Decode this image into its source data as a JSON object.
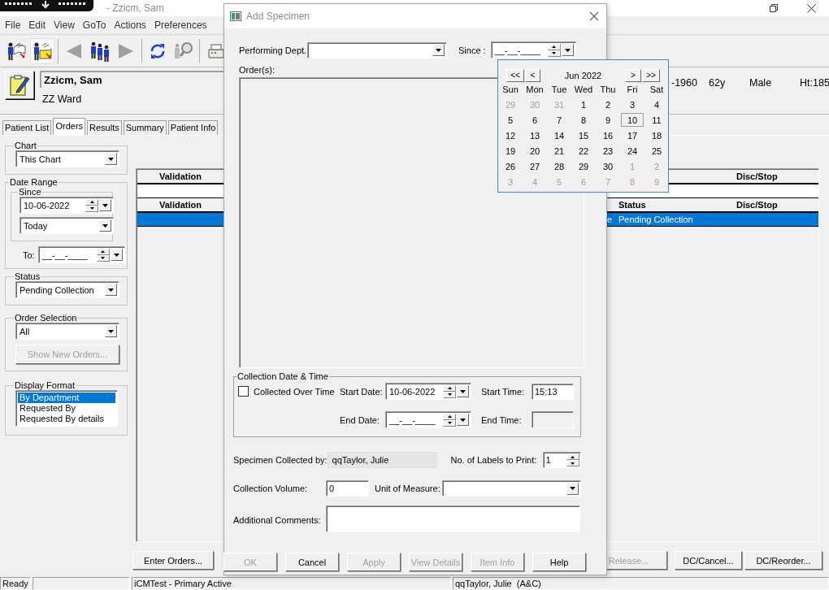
{
  "window": {
    "title": "- Zzicm, Sam"
  },
  "menu": [
    "File",
    "Edit",
    "View",
    "GoTo",
    "Actions",
    "Preferences"
  ],
  "patient": {
    "name": "Zzicm, Sam",
    "ward": "ZZ Ward",
    "dob": "-1960",
    "age": "62y",
    "sex": "Male",
    "height": "Ht:185"
  },
  "tabs": [
    {
      "label": "Patient List",
      "selected": false
    },
    {
      "label": "Orders",
      "selected": true
    },
    {
      "label": "Results",
      "selected": false
    },
    {
      "label": "Summary",
      "selected": false
    },
    {
      "label": "Patient Info",
      "selected": false
    }
  ],
  "filters": {
    "chart": {
      "label": "Chart",
      "value": "This Chart"
    },
    "date_range": {
      "label": "Date Range",
      "since_label": "Since",
      "since_value": "10-06-2022",
      "since_preset": "Today",
      "to_label": "To:",
      "to_value": "__-__-____"
    },
    "status": {
      "label": "Status",
      "value": "Pending Collection"
    },
    "order_selection": {
      "label": "Order Selection",
      "value": "All",
      "button": {
        "label": "Show New Orders...",
        "disabled": true
      }
    },
    "display_format": {
      "label": "Display Format",
      "items": [
        {
          "label": "By Department",
          "selected": true
        },
        {
          "label": "Requested By",
          "selected": false
        },
        {
          "label": "Requested By details",
          "selected": false
        }
      ]
    }
  },
  "orders_tables": [
    {
      "headers": {
        "validation": "Validation",
        "disc_stop": "Disc/Stop"
      },
      "rows": [
        {
          "selected": false
        }
      ]
    },
    {
      "headers": {
        "validation": "Validation",
        "status": "Status",
        "disc_stop": "Disc/Stop"
      },
      "rows": [
        {
          "column_2": "e",
          "status": "Pending Collection",
          "selected": true
        }
      ]
    }
  ],
  "action_buttons": [
    {
      "label": "Enter Orders...",
      "disabled": false
    },
    {
      "label": "Release...",
      "disabled": true
    },
    {
      "label": "DC/Cancel...",
      "disabled": false
    },
    {
      "label": "DC/Reorder...",
      "disabled": false
    }
  ],
  "status_bar": [
    "Ready",
    "iCMTest - Primary Active",
    "qqTaylor, Julie  (A&C)"
  ],
  "dialog": {
    "title": "Add Specimen",
    "performing_dept_label": "Performing Dept.",
    "since_label": "Since :",
    "since_value": "__-__-____",
    "orders_label": "Order(s):",
    "collection": {
      "title": "Collection Date & Time",
      "collected_over_time": {
        "label": "Collected Over Time",
        "checked": false
      },
      "start_date_label": "Start Date:",
      "start_date": "10-06-2022",
      "start_time_label": "Start Time:",
      "start_time": "15:13",
      "end_date_label": "End Date:",
      "end_date": "__-__-____",
      "end_time_label": "End Time:",
      "end_time_disabled": true
    },
    "collected_by_label": "Specimen Collected by:",
    "collected_by": "qqTaylor, Julie",
    "labels_label": "No. of Labels to Print:",
    "labels": "1",
    "volume_label": "Collection Volume:",
    "volume": "0",
    "unit_label": "Unit of Measure:",
    "comments_label": "Additional Comments:",
    "buttons": [
      {
        "label": "OK",
        "disabled": true
      },
      {
        "label": "Cancel",
        "disabled": false
      },
      {
        "label": "Apply",
        "disabled": true
      },
      {
        "label": "View Details",
        "disabled": true
      },
      {
        "label": "Item Info",
        "disabled": true
      },
      {
        "label": "Help",
        "disabled": false
      }
    ]
  },
  "calendar": {
    "month": "Jun 2022",
    "nav_back": [
      "<<",
      "<"
    ],
    "nav_forward": [
      ">",
      ">>"
    ],
    "weekdays": [
      "Sun",
      "Mon",
      "Tue",
      "Wed",
      "Thu",
      "Fri",
      "Sat"
    ],
    "days": [
      {
        "label": "29",
        "other_month": true,
        "selected": false
      },
      {
        "label": "30",
        "other_month": true,
        "selected": false
      },
      {
        "label": "31",
        "other_month": true,
        "selected": false
      },
      {
        "label": "1",
        "other_month": false,
        "selected": false
      },
      {
        "label": "2",
        "other_month": false,
        "selected": false
      },
      {
        "label": "3",
        "other_month": false,
        "selected": false
      },
      {
        "label": "4",
        "other_month": false,
        "selected": false
      },
      {
        "label": "5",
        "other_month": false,
        "selected": false
      },
      {
        "label": "6",
        "other_month": false,
        "selected": false
      },
      {
        "label": "7",
        "other_month": false,
        "selected": false
      },
      {
        "label": "8",
        "other_month": false,
        "selected": false
      },
      {
        "label": "9",
        "other_month": false,
        "selected": false
      },
      {
        "label": "10",
        "other_month": false,
        "selected": true
      },
      {
        "label": "11",
        "other_month": false,
        "selected": false
      },
      {
        "label": "12",
        "other_month": false,
        "selected": false
      },
      {
        "label": "13",
        "other_month": false,
        "selected": false
      },
      {
        "label": "14",
        "other_month": false,
        "selected": false
      },
      {
        "label": "15",
        "other_month": false,
        "selected": false
      },
      {
        "label": "16",
        "other_month": false,
        "selected": false
      },
      {
        "label": "17",
        "other_month": false,
        "selected": false
      },
      {
        "label": "18",
        "other_month": false,
        "selected": false
      },
      {
        "label": "19",
        "other_month": false,
        "selected": false
      },
      {
        "label": "20",
        "other_month": false,
        "selected": false
      },
      {
        "label": "21",
        "other_month": false,
        "selected": false
      },
      {
        "label": "22",
        "other_month": false,
        "selected": false
      },
      {
        "label": "23",
        "other_month": false,
        "selected": false
      },
      {
        "label": "24",
        "other_month": false,
        "selected": false
      },
      {
        "label": "25",
        "other_month": false,
        "selected": false
      },
      {
        "label": "26",
        "other_month": false,
        "selected": false
      },
      {
        "label": "27",
        "other_month": false,
        "selected": false
      },
      {
        "label": "28",
        "other_month": false,
        "selected": false
      },
      {
        "label": "29",
        "other_month": false,
        "selected": false
      },
      {
        "label": "30",
        "other_month": false,
        "selected": false
      },
      {
        "label": "1",
        "other_month": true,
        "selected": false
      },
      {
        "label": "2",
        "other_month": true,
        "selected": false
      },
      {
        "label": "3",
        "other_month": true,
        "selected": false
      },
      {
        "label": "4",
        "other_month": true,
        "selected": false
      },
      {
        "label": "5",
        "other_month": true,
        "selected": false
      },
      {
        "label": "6",
        "other_month": true,
        "selected": false
      },
      {
        "label": "7",
        "other_month": true,
        "selected": false
      },
      {
        "label": "8",
        "other_month": true,
        "selected": false
      },
      {
        "label": "9",
        "other_month": true,
        "selected": false
      }
    ]
  }
}
